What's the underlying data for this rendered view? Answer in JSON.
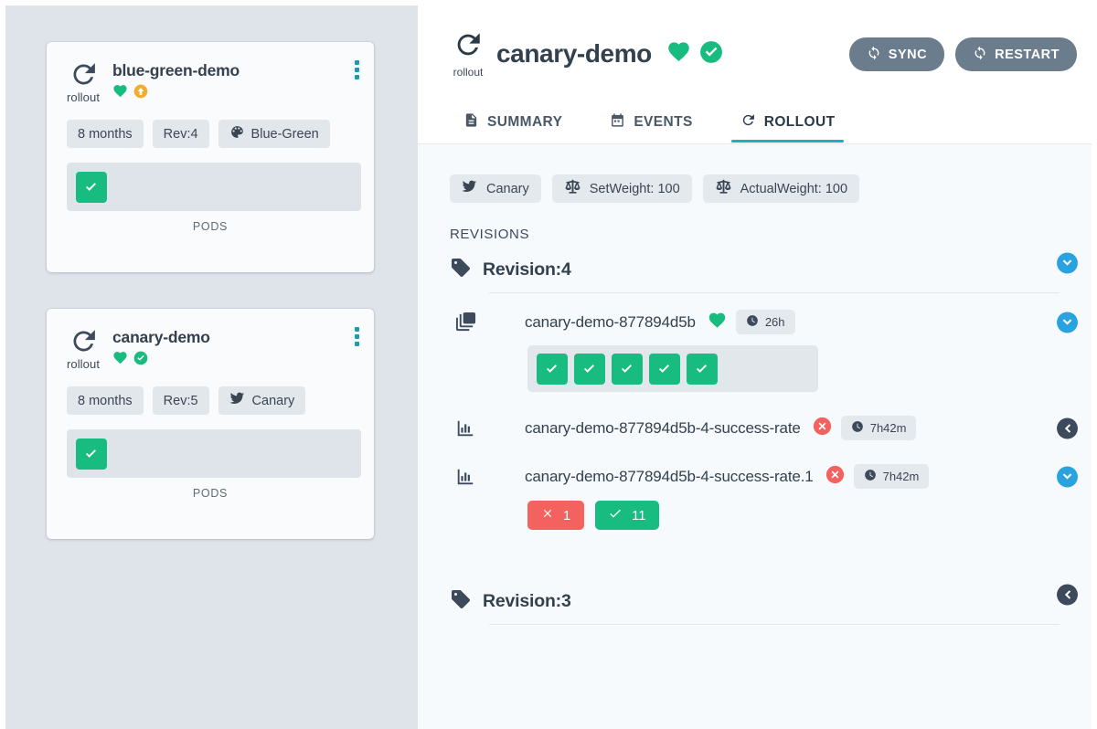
{
  "colors": {
    "sidebar_bg": "#dfe4ea",
    "panel_bg": "#f7fafc",
    "accent_teal": "#1eadbf",
    "green": "#18bc81",
    "red": "#f4625f",
    "orange": "#f0ad2e",
    "blue": "#29a3e0",
    "dark": "#3d4a5c",
    "button_gray": "#6b7d8c",
    "kebab_teal": "#1c9daa"
  },
  "sidebar": {
    "cards": [
      {
        "kind_label": "rollout",
        "kind_icon": "rollout-restart-icon",
        "title": "blue-green-demo",
        "status_icons": [
          {
            "name": "health-heart-icon",
            "color": "#18bc81"
          },
          {
            "name": "progressing-arrow-up-icon",
            "color": "#f0ad2e"
          }
        ],
        "chips": [
          {
            "label": "8 months",
            "icon": null
          },
          {
            "label": "Rev:4",
            "icon": null
          },
          {
            "label": "Blue-Green",
            "icon": "palette-icon"
          }
        ],
        "pods": [
          {
            "state": "healthy"
          }
        ],
        "pods_label": "PODS",
        "menu_icon": "kebab-menu-icon"
      },
      {
        "kind_label": "rollout",
        "kind_icon": "rollout-restart-icon",
        "title": "canary-demo",
        "status_icons": [
          {
            "name": "health-heart-icon",
            "color": "#18bc81"
          },
          {
            "name": "synced-check-circle-icon",
            "color": "#18bc81"
          }
        ],
        "chips": [
          {
            "label": "8 months",
            "icon": null
          },
          {
            "label": "Rev:5",
            "icon": null
          },
          {
            "label": "Canary",
            "icon": "canary-bird-icon"
          }
        ],
        "pods": [
          {
            "state": "healthy"
          }
        ],
        "pods_label": "PODS",
        "menu_icon": "kebab-menu-icon"
      }
    ]
  },
  "header": {
    "kind_label": "rollout",
    "title": "canary-demo",
    "status_icons": [
      {
        "name": "health-heart-icon",
        "color": "#18bc81"
      },
      {
        "name": "synced-check-circle-icon",
        "color": "#18bc81"
      }
    ],
    "sync_label": "SYNC",
    "restart_label": "RESTART"
  },
  "tabs": [
    {
      "label": "SUMMARY",
      "icon": "document-icon",
      "active": false
    },
    {
      "label": "EVENTS",
      "icon": "calendar-icon",
      "active": false
    },
    {
      "label": "ROLLOUT",
      "icon": "rollout-restart-icon",
      "active": true
    }
  ],
  "strategy_badges": [
    {
      "label": "Canary",
      "icon": "canary-bird-icon"
    },
    {
      "label": "SetWeight: 100",
      "icon": "scales-icon"
    },
    {
      "label": "ActualWeight: 100",
      "icon": "scales-icon"
    }
  ],
  "revisions_heading": "REVISIONS",
  "revisions": [
    {
      "title": "Revision:4",
      "toggle": "chevron-down",
      "resources": [
        {
          "icon": "replicaset-icon",
          "name": "canary-demo-877894d5b",
          "status_icon": {
            "name": "health-heart-icon",
            "color": "#18bc81"
          },
          "time": "26h",
          "toggle": "chevron-down",
          "pods": [
            {
              "state": "healthy"
            },
            {
              "state": "healthy"
            },
            {
              "state": "healthy"
            },
            {
              "state": "healthy"
            },
            {
              "state": "healthy"
            }
          ],
          "counters": []
        },
        {
          "icon": "analysisrun-chart-icon",
          "name": "canary-demo-877894d5b-4-success-rate",
          "status_icon": {
            "name": "failed-x-circle-icon",
            "color": "#f4625f"
          },
          "time": "7h42m",
          "toggle": "chevron-left",
          "pods": [],
          "counters": []
        },
        {
          "icon": "analysisrun-chart-icon",
          "name": "canary-demo-877894d5b-4-success-rate.1",
          "status_icon": {
            "name": "failed-x-circle-icon",
            "color": "#f4625f"
          },
          "time": "7h42m",
          "toggle": "chevron-down",
          "pods": [],
          "counters": [
            {
              "kind": "fail",
              "icon": "x-icon",
              "value": "1"
            },
            {
              "kind": "pass",
              "icon": "check-icon",
              "value": "11"
            }
          ]
        }
      ]
    },
    {
      "title": "Revision:3",
      "toggle": "chevron-left",
      "resources": []
    }
  ]
}
